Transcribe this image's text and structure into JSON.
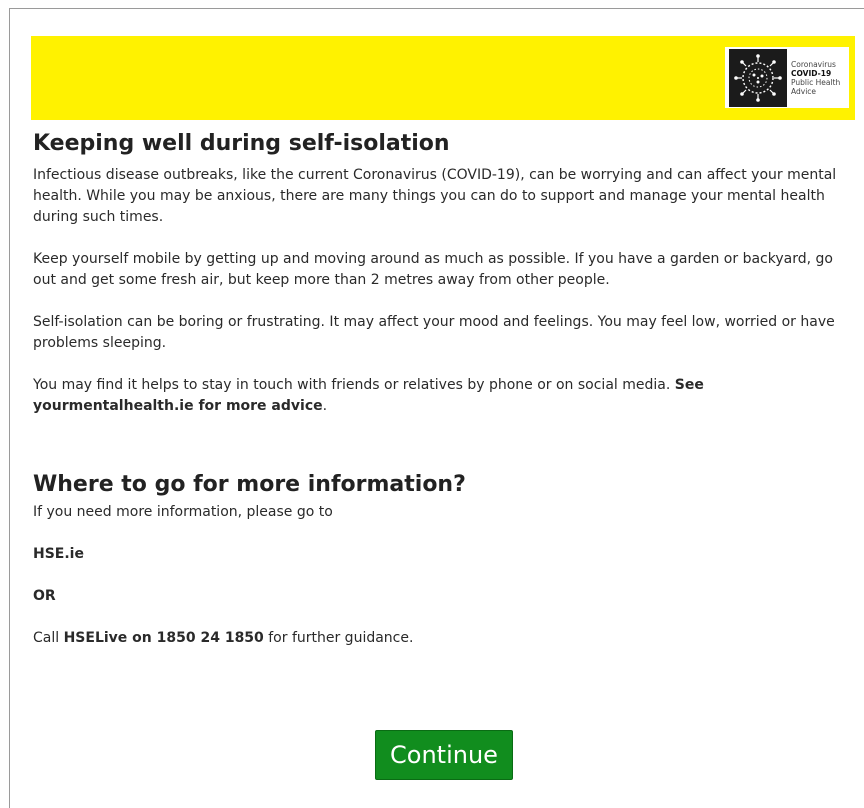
{
  "badge": {
    "line1": "Coronavirus",
    "line2": "COVID-19",
    "line3": "Public Health",
    "line4": "Advice"
  },
  "section1": {
    "title": "Keeping well during self-isolation",
    "p1": "Infectious disease outbreaks, like the current Coronavirus (COVID-19), can be worrying and can affect your mental health. While you may be anxious, there are many things you can do to support and manage your mental health during such times.",
    "p2": "Keep yourself mobile by getting up and moving around as much as possible. If you have a garden or backyard, go out and get some fresh air, but keep more than 2 metres away from other people.",
    "p3": "Self-isolation can be boring or frustrating. It may affect your mood and feelings. You may feel low, worried or have problems sleeping.",
    "p4_prefix": "You may find it helps to stay in touch with friends or relatives by phone or on social media. ",
    "p4_bold": "See yourmentalhealth.ie for more advice",
    "p4_suffix": "."
  },
  "section2": {
    "title": "Where to go for more information?",
    "intro": "If you need more information, please go to",
    "link": "HSE.ie",
    "or": "OR",
    "call_prefix": "Call ",
    "call_bold": "HSELive on 1850 24 1850",
    "call_suffix": " for further guidance."
  },
  "continue_label": "Continue",
  "colors": {
    "banner": "#fff200",
    "button": "#118d1e"
  }
}
